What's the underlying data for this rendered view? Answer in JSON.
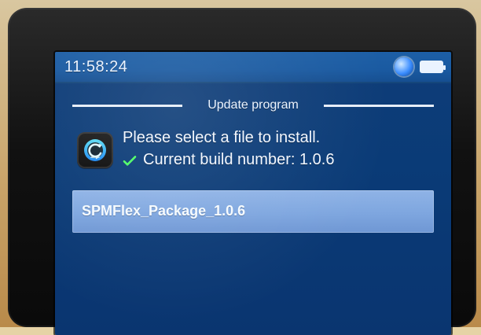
{
  "status": {
    "time": "11:58:24",
    "icons": [
      "status-circle-icon",
      "battery-icon"
    ],
    "colors": {
      "bar": "#1a5aa1",
      "screen": "#0a3b77",
      "text": "#eaf3ff",
      "check": "#4cff63",
      "selected_item": "#7ea6df"
    }
  },
  "dialog": {
    "title": "Update program",
    "message": "Please select a file to install.",
    "build_text": "Current build number: 1.0.6"
  },
  "files": [
    {
      "name": "SPMFlex_Package_1.0.6"
    }
  ]
}
